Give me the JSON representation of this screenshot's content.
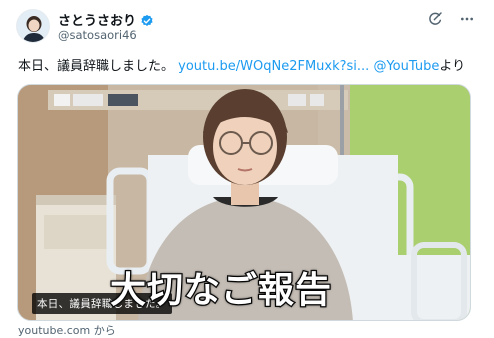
{
  "author": {
    "display_name": "さとうさおり",
    "handle": "@satosaori46",
    "verified_color": "#1d9bf0"
  },
  "icons": {
    "grok": "grok-icon",
    "more": "more-icon"
  },
  "tweet": {
    "text_plain": "本日、議員辞職しました。",
    "link": "youtu.be/WOqNe2FMuxk?si...",
    "mention": "@YouTube",
    "suffix": "より"
  },
  "card": {
    "caption": "本日、議員辞職しました。",
    "overlay_title": "大切なご報告",
    "domain": "youtube.com から"
  },
  "colors": {
    "link": "#1d9bf0",
    "muted": "#536471",
    "wall_green": "#a9cf6e"
  }
}
